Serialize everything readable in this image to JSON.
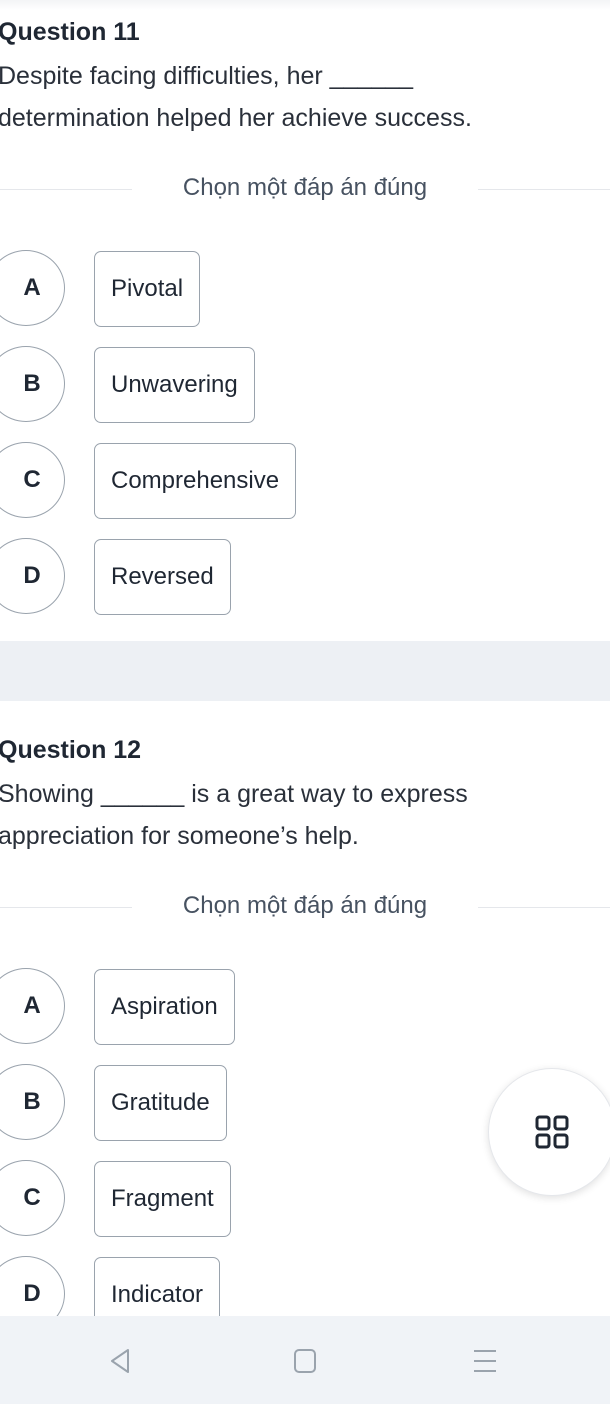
{
  "questions": [
    {
      "title": "Question 11",
      "text_line1": "Despite facing difficulties, her ______",
      "text_line2": "determination helped her achieve success.",
      "instruction": "Chọn một đáp án đúng",
      "options": [
        {
          "letter": "A",
          "text": "Pivotal"
        },
        {
          "letter": "B",
          "text": "Unwavering"
        },
        {
          "letter": "C",
          "text": "Comprehensive"
        },
        {
          "letter": "D",
          "text": "Reversed"
        }
      ]
    },
    {
      "title": "Question 12",
      "text_line1": "Showing ______ is a great way to express",
      "text_line2": "appreciation for someone’s help.",
      "instruction": "Chọn một đáp án đúng",
      "options": [
        {
          "letter": "A",
          "text": "Aspiration"
        },
        {
          "letter": "B",
          "text": "Gratitude"
        },
        {
          "letter": "C",
          "text": "Fragment"
        },
        {
          "letter": "D",
          "text": "Indicator"
        }
      ]
    }
  ],
  "fab": {
    "icon": "grid-icon"
  },
  "navbar": {
    "back": "back-icon",
    "home": "home-icon",
    "menu": "menu-icon"
  }
}
